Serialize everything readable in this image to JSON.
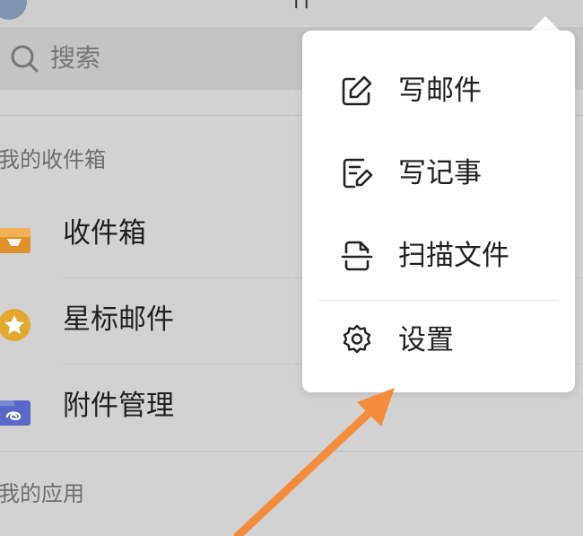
{
  "header": {
    "title_fragment": "件"
  },
  "search": {
    "placeholder": "搜索"
  },
  "sections": {
    "my_folders": "我的收件箱",
    "my_apps": "我的应用"
  },
  "folders": [
    {
      "label": "收件箱",
      "icon": "inbox-tray-icon",
      "color": "#e0922a"
    },
    {
      "label": "星标邮件",
      "icon": "star-circle-icon",
      "color": "#e2a92d"
    },
    {
      "label": "附件管理",
      "icon": "paperclip-folder-icon",
      "color": "#5a68c8"
    }
  ],
  "menu": {
    "items": [
      {
        "label": "写邮件",
        "icon": "compose-edit-icon"
      },
      {
        "label": "写记事",
        "icon": "note-edit-icon"
      },
      {
        "label": "扫描文件",
        "icon": "scan-document-icon"
      },
      {
        "label": "设置",
        "icon": "gear-icon"
      }
    ]
  },
  "annotation": {
    "arrow_color": "#f58c3c",
    "icon": "pointing-arrow-icon"
  }
}
